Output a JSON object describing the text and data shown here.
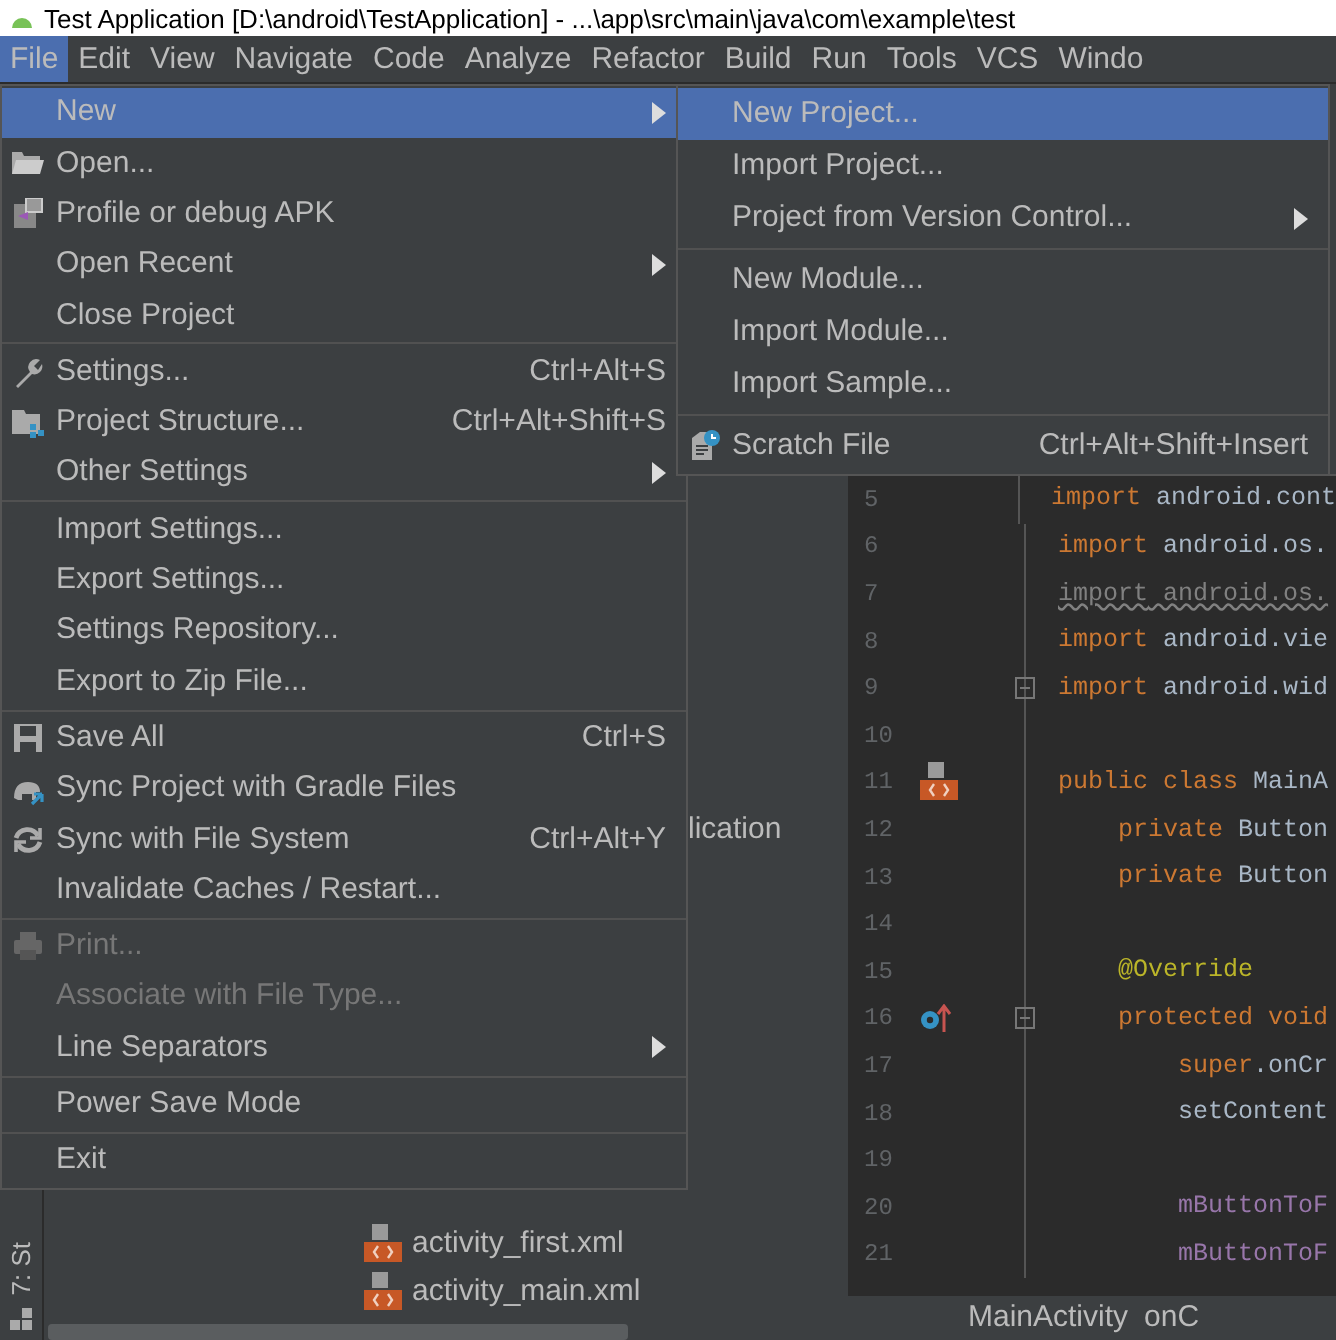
{
  "window": {
    "title": "Test Application [D:\\android\\TestApplication] - ...\\app\\src\\main\\java\\com\\example\\test"
  },
  "menubar": [
    {
      "label": "File",
      "selected": true
    },
    {
      "label": "Edit",
      "selected": false
    },
    {
      "label": "View",
      "selected": false
    },
    {
      "label": "Navigate",
      "selected": false
    },
    {
      "label": "Code",
      "selected": false
    },
    {
      "label": "Analyze",
      "selected": false
    },
    {
      "label": "Refactor",
      "selected": false
    },
    {
      "label": "Build",
      "selected": false
    },
    {
      "label": "Run",
      "selected": false
    },
    {
      "label": "Tools",
      "selected": false
    },
    {
      "label": "VCS",
      "selected": false
    },
    {
      "label": "Windo",
      "selected": false
    }
  ],
  "file_menu": {
    "groups": [
      [
        {
          "label": "New",
          "submenu": true,
          "selected": true,
          "disabled": false
        },
        {
          "label": "Open...",
          "submenu": false,
          "selected": false,
          "disabled": false
        },
        {
          "label": "Profile or debug APK",
          "submenu": false,
          "selected": false,
          "disabled": false
        },
        {
          "label": "Open Recent",
          "submenu": true,
          "selected": false,
          "disabled": false
        },
        {
          "label": "Close Project",
          "submenu": false,
          "selected": false,
          "disabled": false
        }
      ],
      [
        {
          "label": "Settings...",
          "shortcut": "Ctrl+Alt+S",
          "submenu": false,
          "selected": false,
          "disabled": false
        },
        {
          "label": "Project Structure...",
          "shortcut": "Ctrl+Alt+Shift+S",
          "submenu": false,
          "selected": false,
          "disabled": false
        },
        {
          "label": "Other Settings",
          "submenu": true,
          "selected": false,
          "disabled": false
        }
      ],
      [
        {
          "label": "Import Settings...",
          "submenu": false,
          "selected": false,
          "disabled": false
        },
        {
          "label": "Export Settings...",
          "submenu": false,
          "selected": false,
          "disabled": false
        },
        {
          "label": "Settings Repository...",
          "submenu": false,
          "selected": false,
          "disabled": false
        },
        {
          "label": "Export to Zip File...",
          "submenu": false,
          "selected": false,
          "disabled": false
        }
      ],
      [
        {
          "label": "Save All",
          "shortcut": "Ctrl+S",
          "submenu": false,
          "selected": false,
          "disabled": false
        },
        {
          "label": "Sync Project with Gradle Files",
          "submenu": false,
          "selected": false,
          "disabled": false
        },
        {
          "label": "Sync with File System",
          "shortcut": "Ctrl+Alt+Y",
          "submenu": false,
          "selected": false,
          "disabled": false
        },
        {
          "label": "Invalidate Caches / Restart...",
          "submenu": false,
          "selected": false,
          "disabled": false
        }
      ],
      [
        {
          "label": "Print...",
          "submenu": false,
          "selected": false,
          "disabled": true
        },
        {
          "label": "Associate with File Type...",
          "submenu": false,
          "selected": false,
          "disabled": true
        },
        {
          "label": "Line Separators",
          "submenu": true,
          "selected": false,
          "disabled": false
        }
      ],
      [
        {
          "label": "Power Save Mode",
          "submenu": false,
          "selected": false,
          "disabled": false
        }
      ],
      [
        {
          "label": "Exit",
          "submenu": false,
          "selected": false,
          "disabled": false
        }
      ]
    ]
  },
  "new_submenu": {
    "groups": [
      [
        {
          "label": "New Project...",
          "submenu": false,
          "selected": true,
          "disabled": false
        },
        {
          "label": "Import Project...",
          "submenu": false,
          "selected": false,
          "disabled": false
        },
        {
          "label": "Project from Version Control...",
          "submenu": true,
          "selected": false,
          "disabled": false
        }
      ],
      [
        {
          "label": "New Module...",
          "submenu": false,
          "selected": false,
          "disabled": false
        },
        {
          "label": "Import Module...",
          "submenu": false,
          "selected": false,
          "disabled": false
        },
        {
          "label": "Import Sample...",
          "submenu": false,
          "selected": false,
          "disabled": false
        }
      ],
      [
        {
          "label": "Scratch File",
          "shortcut": "Ctrl+Alt+Shift+Insert",
          "submenu": false,
          "selected": false,
          "disabled": false
        }
      ]
    ]
  },
  "left_strip": {
    "label": "7: St"
  },
  "project_tree": [
    {
      "label": "lication",
      "kind": "module"
    },
    {
      "label": "activity_first.xml",
      "kind": "xml"
    },
    {
      "label": "activity_main.xml",
      "kind": "xml"
    }
  ],
  "editor": {
    "lines": [
      {
        "number": "5",
        "tokens": [
          {
            "kind": "keyword",
            "text": "import"
          },
          {
            "kind": "plain",
            "text": " android.cont"
          }
        ]
      },
      {
        "number": "6",
        "tokens": [
          {
            "kind": "keyword",
            "text": "import"
          },
          {
            "kind": "plain",
            "text": " android.os."
          }
        ]
      },
      {
        "number": "7",
        "unused": true,
        "tokens": [
          {
            "kind": "keyword",
            "text": "import"
          },
          {
            "kind": "plain",
            "text": " android.os."
          }
        ]
      },
      {
        "number": "8",
        "tokens": [
          {
            "kind": "keyword",
            "text": "import"
          },
          {
            "kind": "plain",
            "text": " android.vie"
          }
        ]
      },
      {
        "number": "9",
        "tokens": [
          {
            "kind": "keyword",
            "text": "import"
          },
          {
            "kind": "plain",
            "text": " android.wid"
          }
        ]
      },
      {
        "number": "10"
      },
      {
        "number": "11",
        "tokens": [
          {
            "kind": "keyword",
            "text": "public class"
          },
          {
            "kind": "plain",
            "text": " MainA"
          }
        ]
      },
      {
        "number": "12",
        "tokens": [
          {
            "kind": "keyword",
            "text": "    private"
          },
          {
            "kind": "plain",
            "text": " Button"
          }
        ]
      },
      {
        "number": "13",
        "tokens": [
          {
            "kind": "keyword",
            "text": "    private"
          },
          {
            "kind": "plain",
            "text": " Button"
          }
        ]
      },
      {
        "number": "14"
      },
      {
        "number": "15",
        "tokens": [
          {
            "kind": "annotation",
            "text": "    @Override"
          }
        ]
      },
      {
        "number": "16",
        "tokens": [
          {
            "kind": "keyword",
            "text": "    protected void"
          }
        ]
      },
      {
        "number": "17",
        "tokens": [
          {
            "kind": "keyword",
            "text": "        super"
          },
          {
            "kind": "plain",
            "text": ".onCr"
          }
        ]
      },
      {
        "number": "18",
        "tokens": [
          {
            "kind": "plain",
            "text": "        setContent"
          }
        ]
      },
      {
        "number": "19"
      },
      {
        "number": "20",
        "tokens": [
          {
            "kind": "field",
            "text": "        mButtonToF"
          }
        ]
      },
      {
        "number": "21",
        "tokens": [
          {
            "kind": "field",
            "text": "        mButtonToF"
          }
        ]
      }
    ]
  },
  "breadcrumb": [
    "MainActivity",
    "onC"
  ]
}
